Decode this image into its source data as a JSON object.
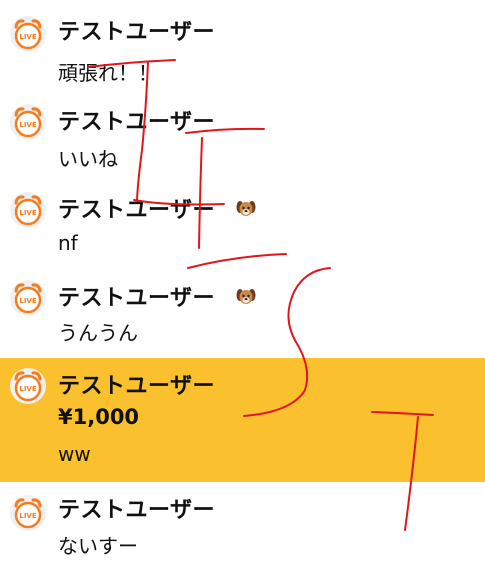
{
  "colors": {
    "highlight_bg": "#fbc02d",
    "avatar_orange": "#f47b20",
    "scribble_red": "#e0161d"
  },
  "messages": [
    {
      "username": "テストユーザー",
      "text": "頑張れ！！",
      "avatar_icon": "live-clock-icon"
    },
    {
      "username": "テストユーザー",
      "text": "いいね",
      "avatar_icon": "live-clock-icon"
    },
    {
      "username": "テストユーザー",
      "text": "nf",
      "avatar_icon": "live-clock-icon",
      "badge_icon": "dog-badge-icon"
    },
    {
      "username": "テストユーザー",
      "text": "うんうん",
      "avatar_icon": "live-clock-icon",
      "badge_icon": "dog-badge-icon"
    },
    {
      "username": "テストユーザー",
      "amount": "¥1,000",
      "text": "ww",
      "avatar_icon": "live-clock-icon",
      "highlighted": true
    },
    {
      "username": "テストユーザー",
      "text": "ないすー",
      "avatar_icon": "live-clock-icon"
    }
  ],
  "avatar_label": "LIVE",
  "annotation": {
    "strokes": 4,
    "color": "red"
  }
}
